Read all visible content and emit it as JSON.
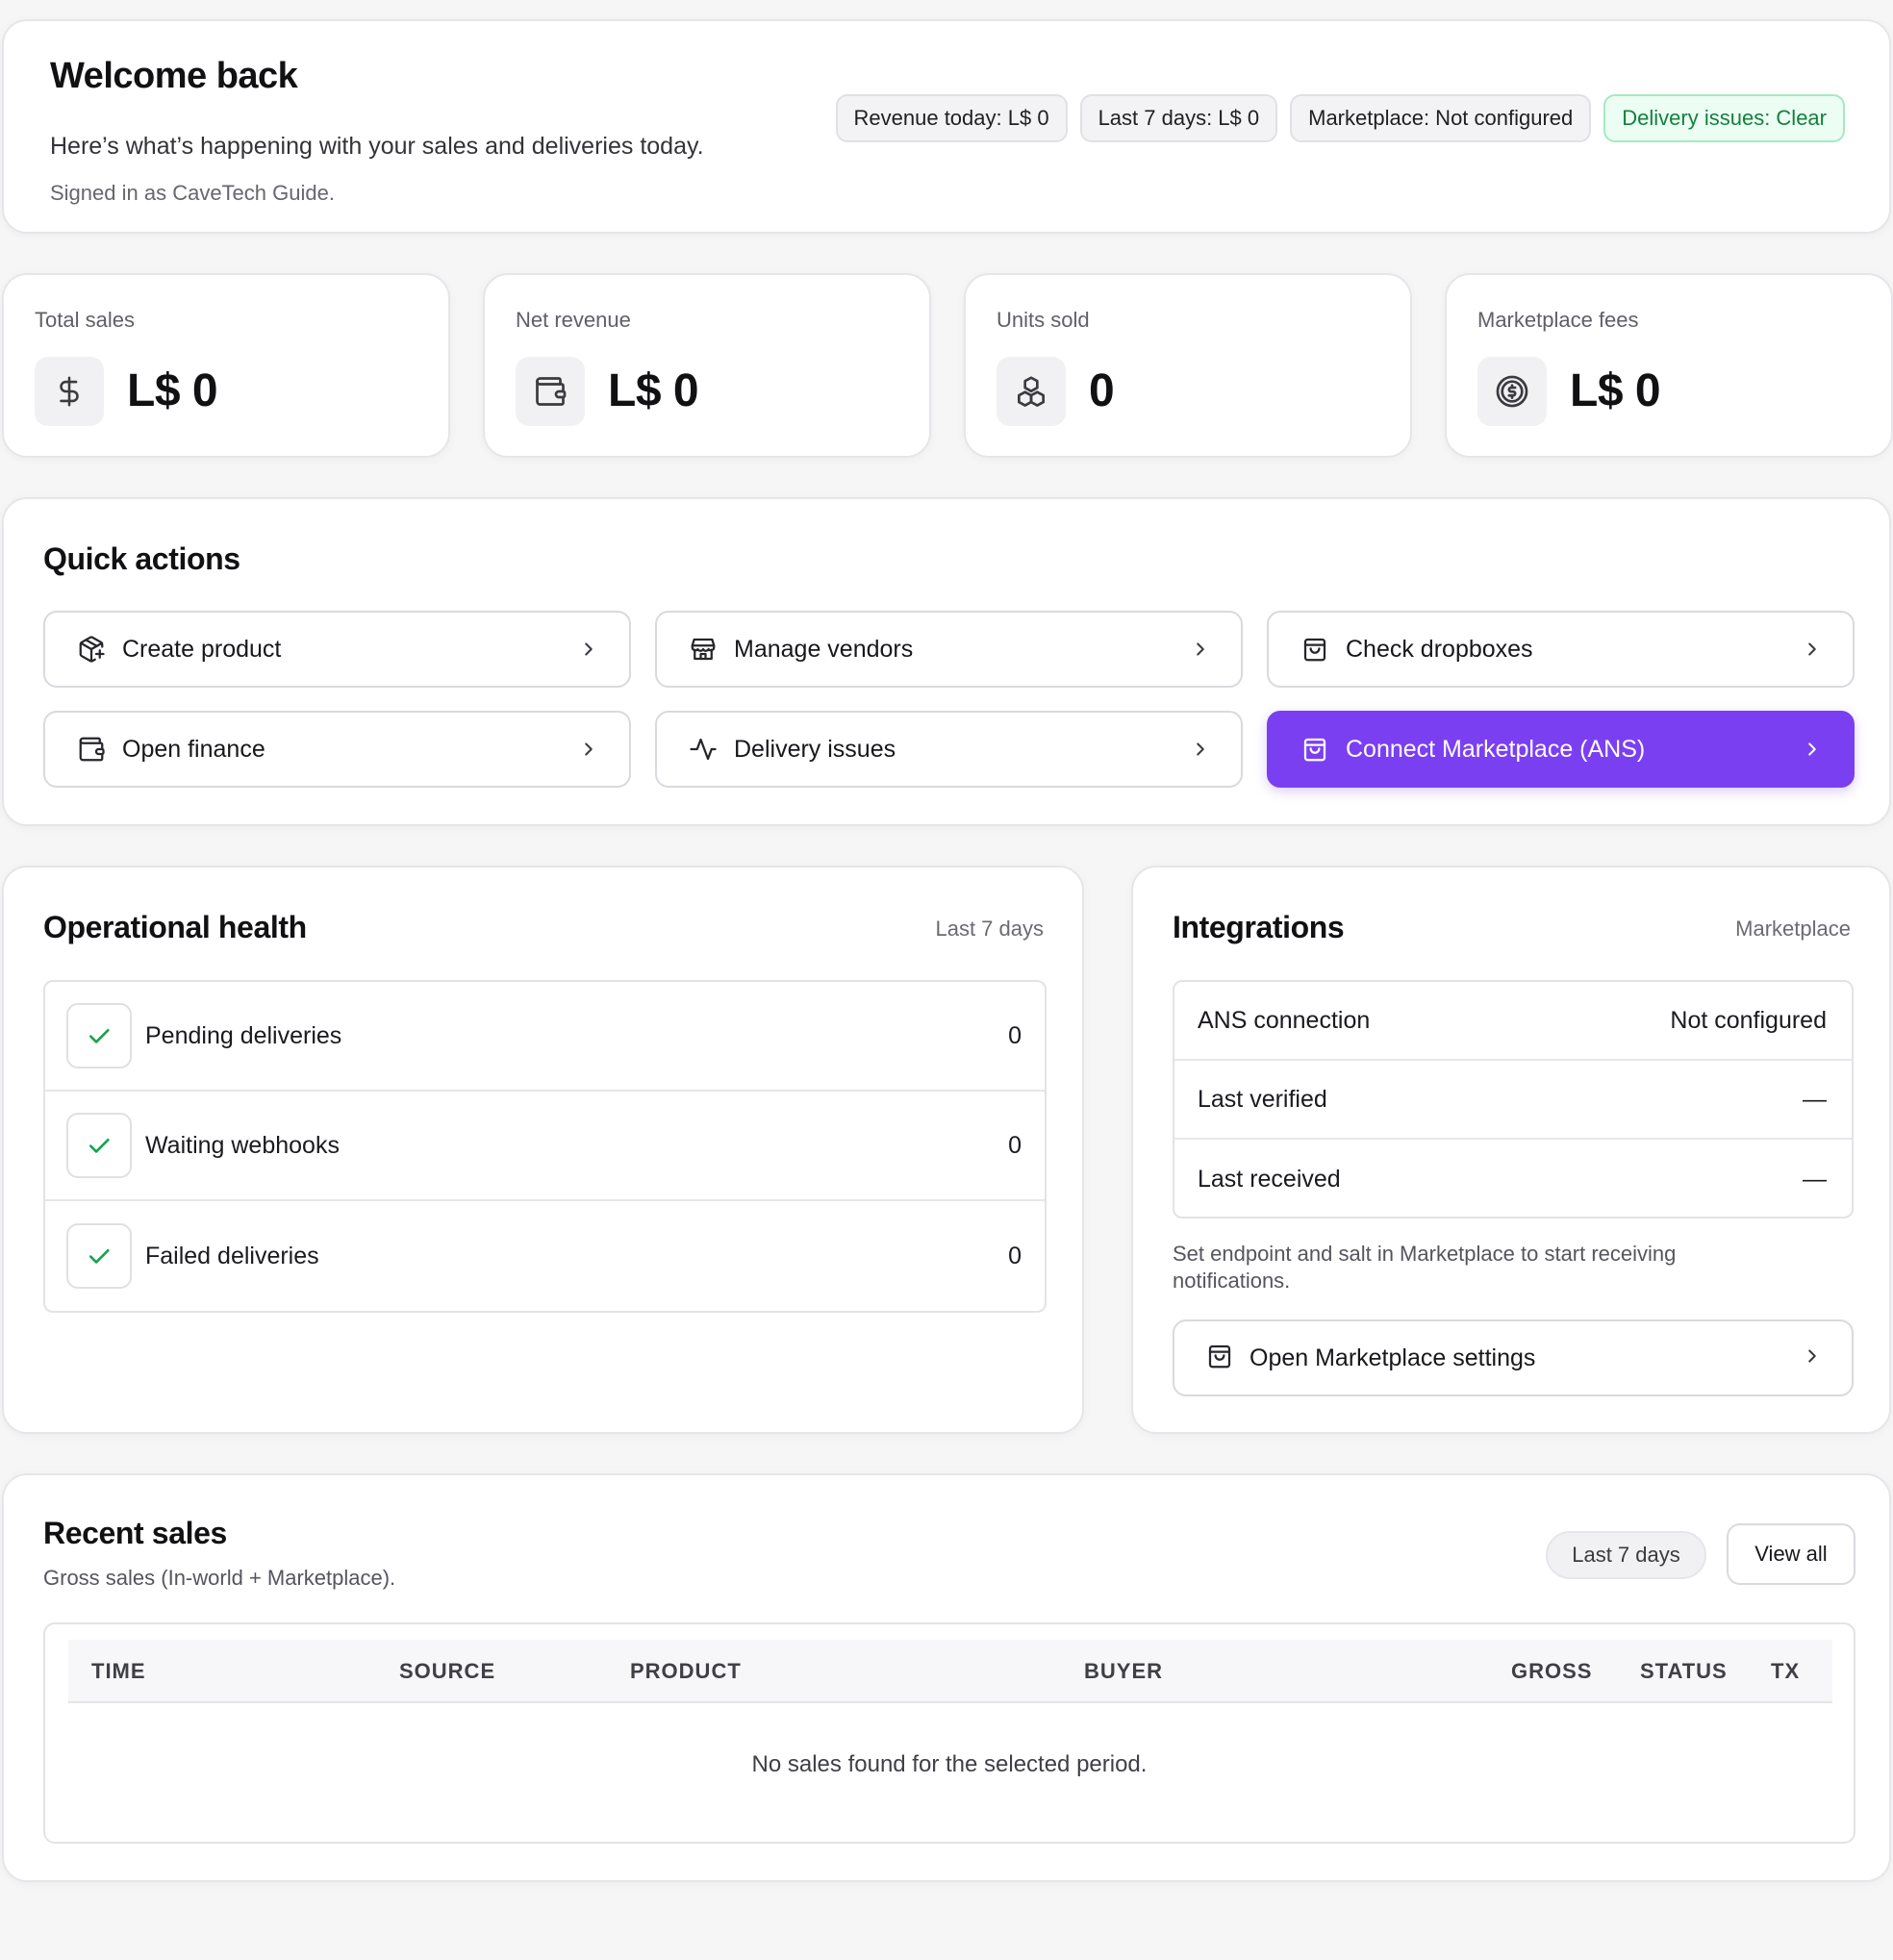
{
  "welcome": {
    "title": "Welcome back",
    "subtitle": "Here’s what’s happening with your sales and deliveries today.",
    "signed_in": "Signed in as CaveTech Guide.",
    "pills": {
      "revenue_today": "Revenue today: L$ 0",
      "last_7_days": "Last 7 days: L$ 0",
      "marketplace": "Marketplace: Not configured",
      "delivery_issues": "Delivery issues: Clear"
    }
  },
  "stats": [
    {
      "label": "Total sales",
      "value": "L$ 0",
      "icon": "dollar-icon"
    },
    {
      "label": "Net revenue",
      "value": "L$ 0",
      "icon": "wallet-icon"
    },
    {
      "label": "Units sold",
      "value": "0",
      "icon": "boxes-icon"
    },
    {
      "label": "Marketplace fees",
      "value": "L$ 0",
      "icon": "coin-dollar-icon"
    }
  ],
  "quick_actions": {
    "title": "Quick actions",
    "items": [
      {
        "label": "Create product",
        "icon": "package-plus-icon"
      },
      {
        "label": "Manage vendors",
        "icon": "store-icon"
      },
      {
        "label": "Check dropboxes",
        "icon": "bag-icon"
      },
      {
        "label": "Open finance",
        "icon": "wallet-icon"
      },
      {
        "label": "Delivery issues",
        "icon": "activity-icon"
      },
      {
        "label": "Connect Marketplace (ANS)",
        "icon": "bag-icon"
      }
    ]
  },
  "operational_health": {
    "title": "Operational health",
    "period": "Last 7 days",
    "rows": [
      {
        "label": "Pending deliveries",
        "value": "0"
      },
      {
        "label": "Waiting webhooks",
        "value": "0"
      },
      {
        "label": "Failed deliveries",
        "value": "0"
      }
    ]
  },
  "integrations": {
    "title": "Integrations",
    "meta": "Marketplace",
    "rows": [
      {
        "label": "ANS connection",
        "value": "Not configured"
      },
      {
        "label": "Last verified",
        "value": "—"
      },
      {
        "label": "Last received",
        "value": "—"
      }
    ],
    "note": "Set endpoint and salt in Marketplace to start receiving notifications.",
    "button": "Open Marketplace settings"
  },
  "recent_sales": {
    "title": "Recent sales",
    "subtitle": "Gross sales (In-world + Marketplace).",
    "period_pill": "Last 7 days",
    "view_all": "View all",
    "columns": [
      "TIME",
      "SOURCE",
      "PRODUCT",
      "BUYER",
      "GROSS",
      "STATUS",
      "TX"
    ],
    "empty": "No sales found for the selected period."
  },
  "colors": {
    "accent": "#7b3ff2",
    "success_green": "#16a34a",
    "success_bg": "#ecfdf3"
  }
}
